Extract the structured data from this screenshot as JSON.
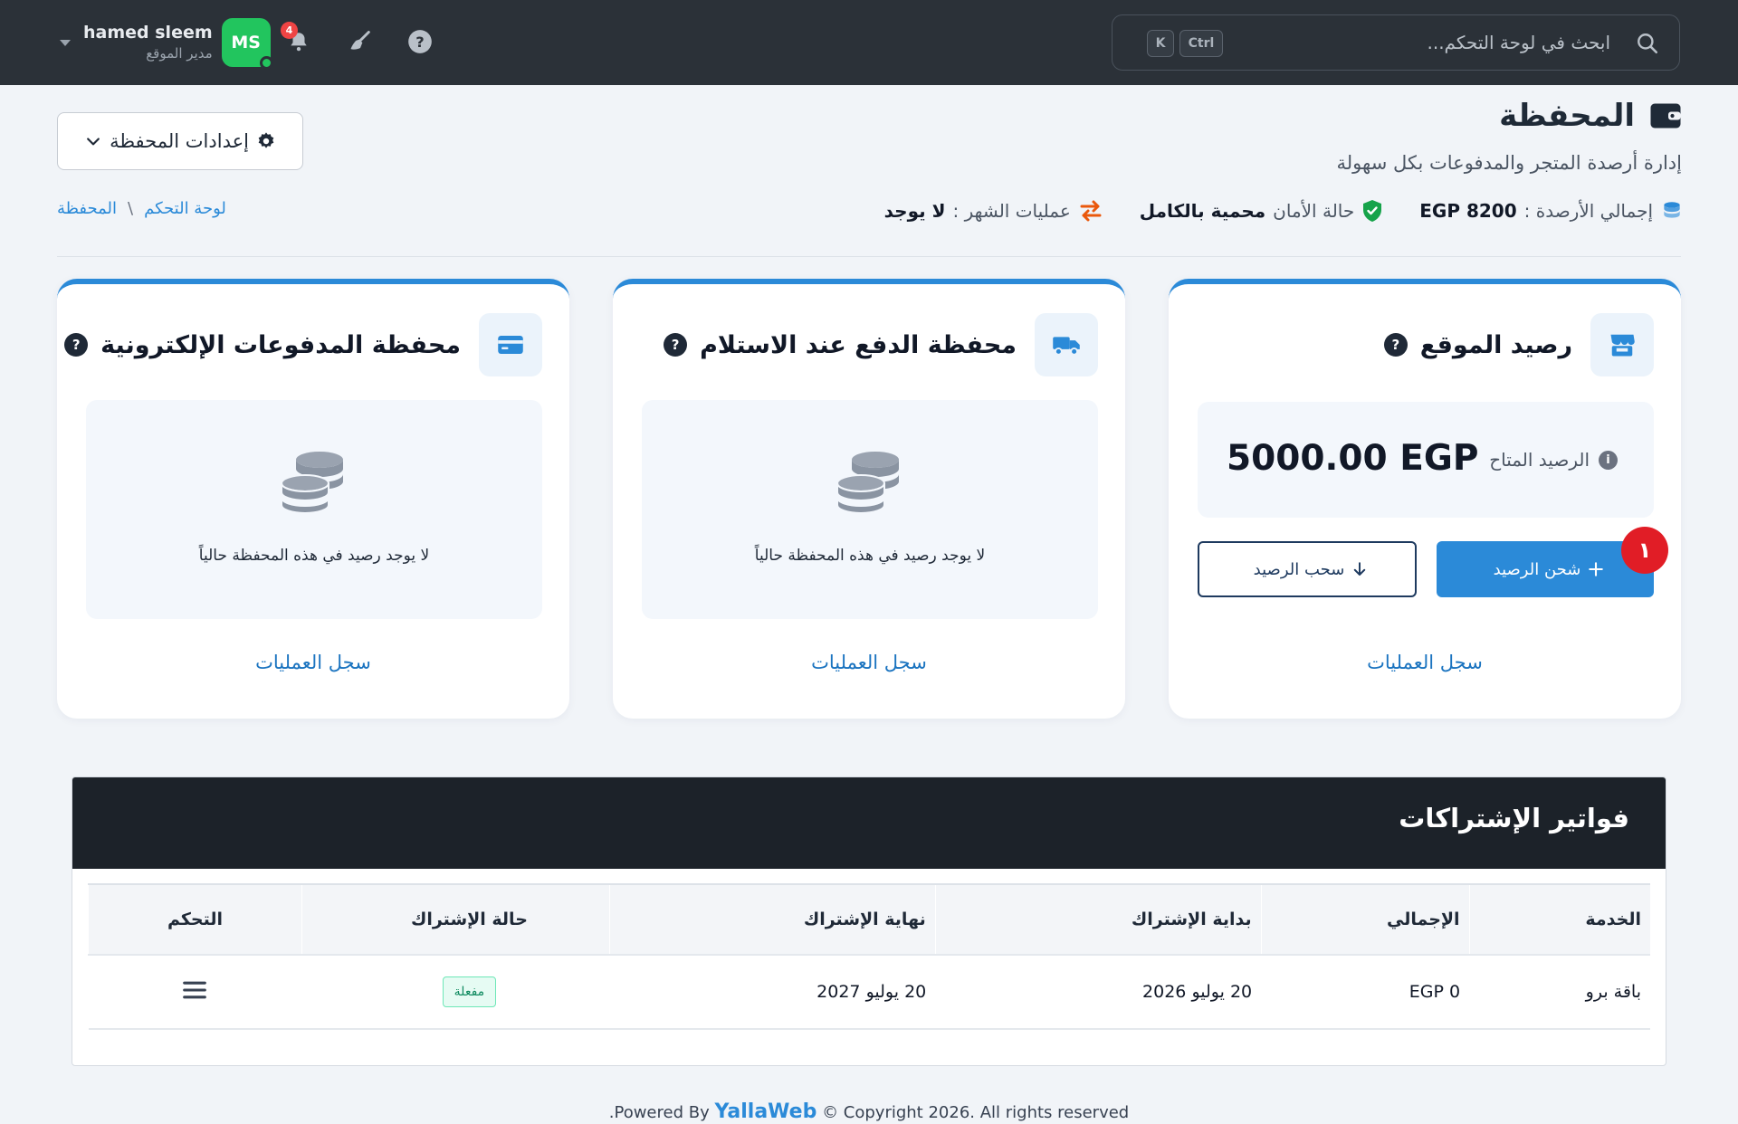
{
  "topbar": {
    "user_name": "hamed sleem",
    "user_role": "مدير الموقع",
    "avatar_initials": "MS",
    "notifications_count": "4",
    "search_placeholder": "ابحث في لوحة التحكم...",
    "shortcut_ctrl": "Ctrl",
    "shortcut_k": "K"
  },
  "header": {
    "title": "المحفظة",
    "subtitle": "إدارة أرصدة المتجر والمدفوعات بكل سهولة",
    "settings_label": "إعدادات المحفظة",
    "breadcrumb": [
      "لوحة التحكم",
      "المحفظة"
    ],
    "breadcrumb_sep": "\\",
    "stats": {
      "total_label": "إجمالي الأرصدة :",
      "total_value": "EGP 8200",
      "security_label": "حالة الأمان",
      "security_value": "محمية بالكامل",
      "monthly_label": "عمليات الشهر :",
      "monthly_value": "لا يوجد"
    }
  },
  "cards": {
    "site": {
      "title": "رصيد الموقع",
      "balance_label": "الرصيد المتاح",
      "balance_amount": "5000.00 EGP",
      "charge_label": "شحن الرصيد",
      "withdraw_label": "سحب الرصيد",
      "step_badge": "١",
      "ops_link": "سجل العمليات"
    },
    "cod": {
      "title": "محفظة الدفع عند الاستلام",
      "empty_text": "لا يوجد رصيد في هذه المحفظة حالياً",
      "ops_link": "سجل العمليات"
    },
    "epay": {
      "title": "محفظة المدفوعات الإلكترونية",
      "empty_text": "لا يوجد رصيد في هذه المحفظة حالياً",
      "ops_link": "سجل العمليات"
    },
    "help_glyph": "?"
  },
  "invoices": {
    "title": "فواتير الإشتراكات",
    "columns": [
      "الخدمة",
      "الإجمالي",
      "بداية الإشتراك",
      "نهاية الإشتراك",
      "حالة الإشتراك",
      "التحكم"
    ],
    "rows": [
      {
        "service": "باقة برو",
        "total": "EGP 0",
        "start": "20 يوليو 2026",
        "end": "20 يوليو 2027",
        "status": "مفعلة"
      }
    ]
  },
  "footer": {
    "powered_prefix": ".Powered By",
    "brand": "YallaWeb",
    "copyright": "© Copyright 2026. All rights reserved"
  },
  "colors": {
    "topbar_bg": "#2b3138",
    "accent": "#2b8ad8",
    "avatar_green": "#22c55e",
    "badge_red": "#e11d26",
    "invoices_header": "#1c2229"
  }
}
